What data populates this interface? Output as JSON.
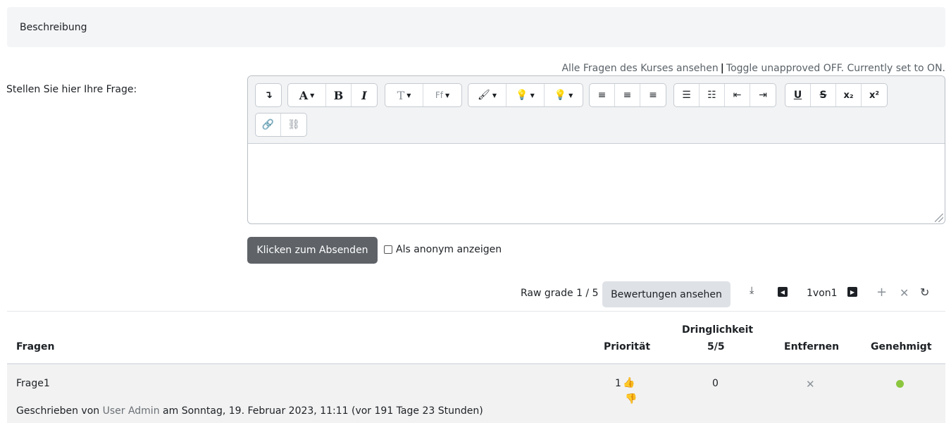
{
  "description": {
    "title": "Beschreibung"
  },
  "links": {
    "all_questions": "Alle Fragen des Kurses ansehen",
    "separator": "|",
    "toggle": "Toggle unapproved OFF. Currently set to ON."
  },
  "form": {
    "question_label": "Stellen Sie hier Ihre Frage:",
    "submit": "Klicken zum Absenden",
    "anonymous": "Als anonym anzeigen"
  },
  "toolbar": {
    "collapse": "↴",
    "font_color": "A",
    "bold": "B",
    "italic": "I",
    "font_size": "T",
    "font_family": "Ff",
    "subscript": "x₂",
    "superscript": "x²"
  },
  "grading": {
    "raw_grade": "Raw grade 1 / 5",
    "ratings_button": "Bewertungen ansehen",
    "page_info": "1von1"
  },
  "table": {
    "headers": {
      "questions": "Fragen",
      "priority": "Priorität",
      "urgency": "Dringlichkeit",
      "urgency_sub": "5/5",
      "remove": "Entfernen",
      "approved": "Genehmigt"
    },
    "rows": [
      {
        "question": "Frage1",
        "priority": "1",
        "urgency": "0",
        "written_by": "Geschrieben von",
        "author": "User Admin",
        "date": "am Sonntag, 19. Februar 2023, 11:11 (vor 191 Tage 23 Stunden)",
        "approved_color": "#8cc63f"
      }
    ]
  },
  "icons": {
    "download": "download-icon",
    "prev": "page-prev-icon",
    "next": "page-next-icon",
    "add": "add-icon",
    "close": "close-icon",
    "refresh": "refresh-icon",
    "thumb_up": "thumb-up-icon",
    "thumb_down": "thumb-down-icon"
  }
}
